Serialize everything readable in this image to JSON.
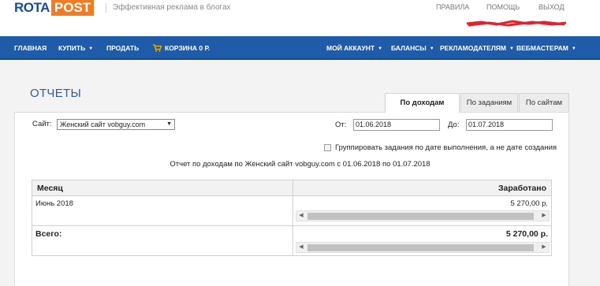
{
  "header": {
    "logo_part1": "ROTA",
    "logo_part2": "POST",
    "tagline": "Эффективная реклама в блогах",
    "links": [
      "ПРАВИЛА",
      "ПОМОЩЬ",
      "ВЫХОД"
    ]
  },
  "nav": {
    "main": "ГЛАВНАЯ",
    "buy": "КУПИТЬ",
    "sell": "ПРОДАТЬ",
    "cart": "КОРЗИНА 0 Р.",
    "account": "МОЙ АККАУНТ",
    "balances": "БАЛАНСЫ",
    "advertisers": "РЕКЛАМОДАТЕЛЯМ",
    "webmasters": "ВЕБМАСТЕРАМ"
  },
  "page": {
    "title": "ОТЧЕТЫ",
    "tabs": [
      "По доходам",
      "По заданиям",
      "По сайтам"
    ]
  },
  "filters": {
    "site_label": "Сайт:",
    "site_value": "Женский сайт vobguy.com",
    "from_label": "От:",
    "from_value": "01.06.2018",
    "to_label": "До:",
    "to_value": "01.07.2018",
    "group_label": "Группировать задания по дате выполнения, а не дате создания"
  },
  "report": {
    "heading": "Отчет  по доходам по Женский сайт  vobguy.com с 01.06.2018 по 01.07.2018",
    "col_month": "Месяц",
    "col_earned": "Заработано",
    "rows": [
      {
        "month": "Июнь 2018",
        "earned": "5 270,00 р."
      }
    ],
    "total_label": "Всего:",
    "total_value": "5 270,00 р."
  },
  "colors": {
    "nav_bg": "#1f5ba8",
    "logo_accent": "#f47b20",
    "title_blue": "#2b5d9c"
  }
}
